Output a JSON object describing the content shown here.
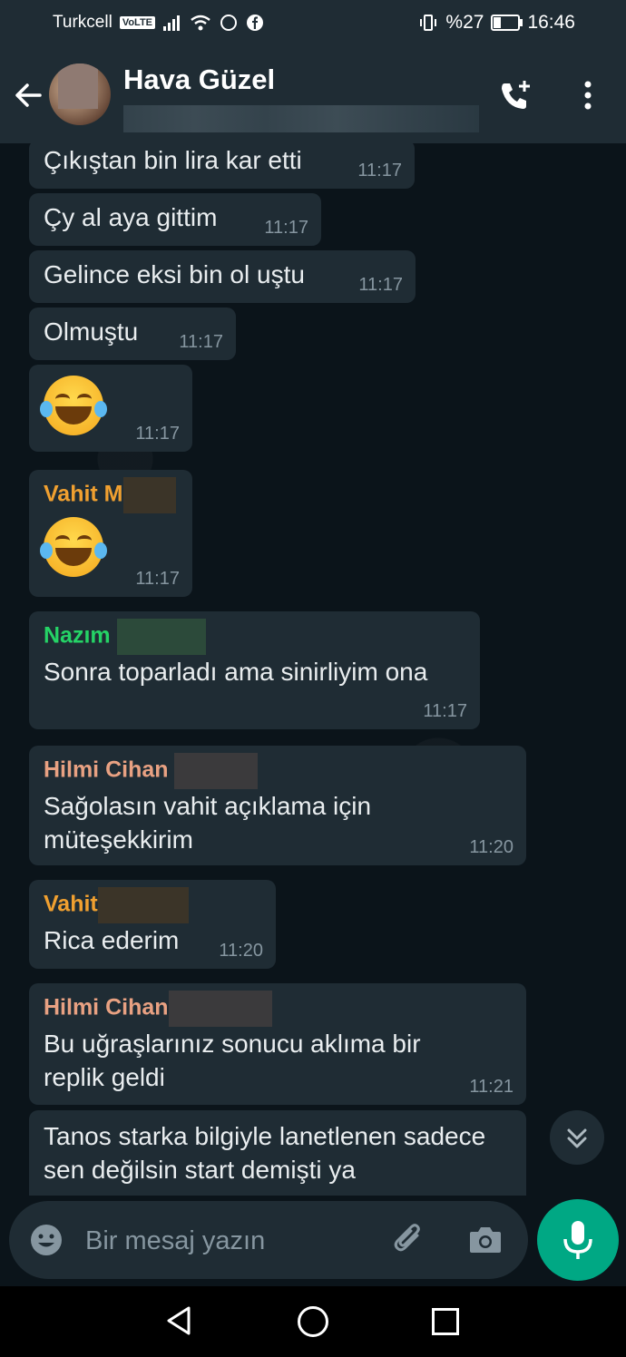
{
  "status_bar": {
    "carrier": "Turkcell",
    "volte": "VoLTE",
    "battery_text": "%27",
    "battery_level": 0.27,
    "time": "16:46"
  },
  "header": {
    "title": "Hava Güzel"
  },
  "messages": [
    {
      "text": "Çıkıştan bin lira kar etti",
      "time": "11:17"
    },
    {
      "text": "Çy al aya gittim",
      "time": "11:17"
    },
    {
      "text": "Gelince eksi bin ol uştu",
      "time": "11:17"
    },
    {
      "text": "Olmuştu",
      "time": "11:17"
    },
    {
      "emoji": "face-with-tears-of-joy",
      "time": "11:17"
    },
    {
      "sender": "Vahit M",
      "sender_color": "#f0a030",
      "emoji": "face-with-tears-of-joy",
      "time": "11:17"
    },
    {
      "sender": "Nazım",
      "sender_color": "#25d366",
      "text": "Sonra toparladı ama sinirliyim ona",
      "time": "11:17"
    },
    {
      "sender": "Hilmi Cihan",
      "sender_color": "#e8a182",
      "text": "Sağolasın vahit açıklama için müteşekkirim",
      "time": "11:20"
    },
    {
      "sender": "Vahit",
      "sender_color": "#f0a030",
      "text": "Rica ederim",
      "time": "11:20"
    },
    {
      "sender": "Hilmi Cihan",
      "sender_color": "#e8a182",
      "text": "Bu uğraşlarınız sonucu aklıma bir replik geldi",
      "time": "11:21"
    },
    {
      "text": "Tanos starka bilgiyle lanetlenen sadece sen değilsin start demişti ya"
    }
  ],
  "composer": {
    "placeholder": "Bir mesaj yazın"
  },
  "colors": {
    "accent": "#00a884",
    "bubble": "#1f2c34",
    "background": "#0b141a"
  },
  "icons": [
    "back-arrow-icon",
    "add-call-icon",
    "more-vert-icon",
    "emoji-icon",
    "attach-icon",
    "camera-icon",
    "mic-icon",
    "chevron-double-down-icon"
  ]
}
